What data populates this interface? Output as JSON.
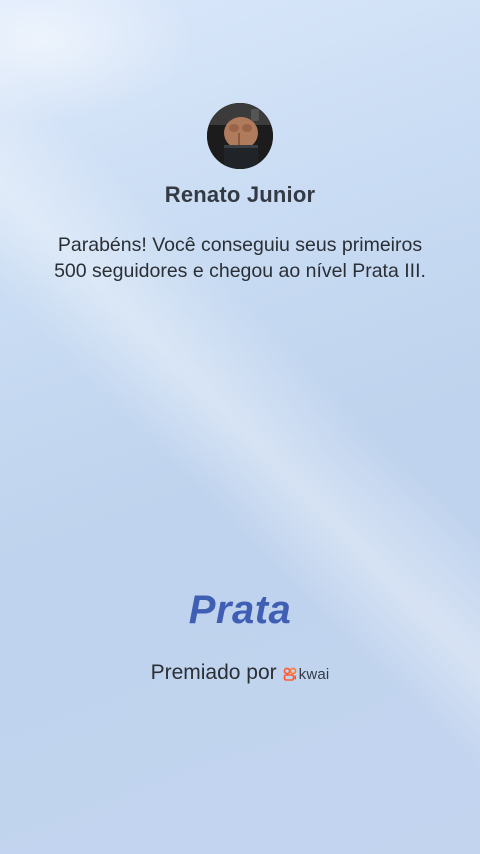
{
  "profile": {
    "name": "Renato Junior"
  },
  "message": {
    "text": "Parabéns! Você conseguiu seus primeiros 500 seguidores e chegou ao nível Prata III."
  },
  "tier": {
    "label": "Prata",
    "color": "#3f5fb4"
  },
  "sponsor": {
    "label": "Premiado por",
    "brand_name": "kwai",
    "brand_icon": "kwai-logo-icon",
    "brand_color": "#ff5a2c"
  },
  "colors": {
    "background_top": "#dbe8fb",
    "background_bottom": "#c3d4ef",
    "text": "#2a2f36"
  }
}
